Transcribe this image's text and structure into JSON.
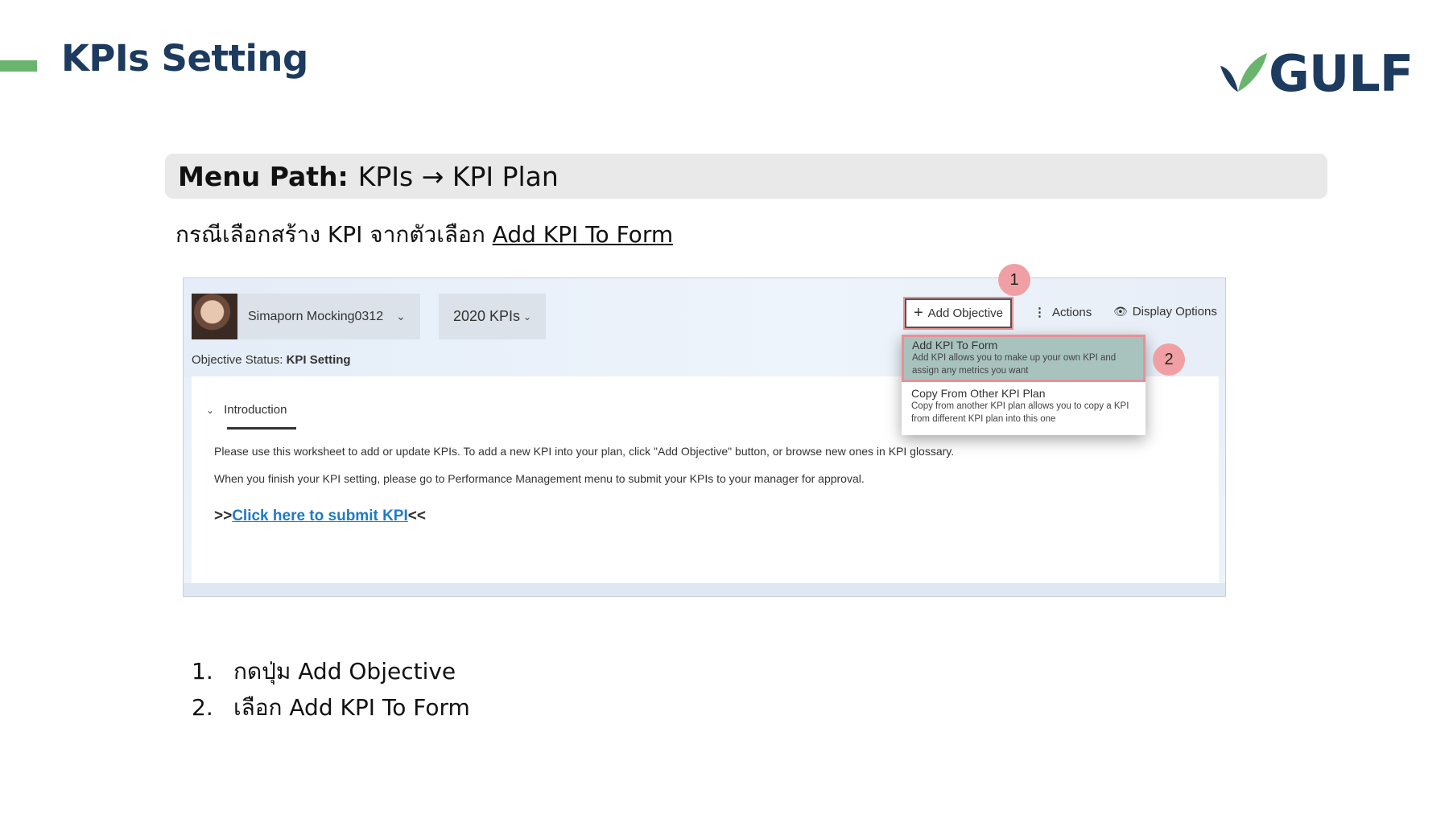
{
  "header": {
    "title": "KPIs Setting",
    "logo_text": "GULF",
    "colors": {
      "accent": "#69b56e",
      "title": "#1d3a5f"
    }
  },
  "menu_path": {
    "label": "Menu Path:",
    "path": "KPIs → KPI Plan"
  },
  "instruction": {
    "prefix": "กรณีเลือกสร้าง KPI จากตัวเลือก ",
    "link": "Add KPI To Form"
  },
  "screenshot": {
    "user_name": "Simaporn Mocking0312",
    "plan_name": "2020 KPIs",
    "objective_status_label": "Objective Status: ",
    "objective_status_value": "KPI Setting",
    "toolbar": {
      "add_objective": "Add Objective",
      "actions": "Actions",
      "display_options": "Display Options"
    },
    "dropdown": [
      {
        "title": "Add KPI To Form",
        "description": "Add KPI allows you to make up your own KPI and assign any metrics you want"
      },
      {
        "title": "Copy From Other KPI Plan",
        "description": "Copy from another KPI plan allows you to copy a KPI from different KPI plan into this one"
      }
    ],
    "intro_tab": "Introduction",
    "paragraph1": "Please use this worksheet to add or update KPIs. To add a new KPI into your plan, click \"Add Objective\" button, or browse new ones in KPI glossary.",
    "paragraph2": "When you finish your KPI setting, please go to Performance Management menu to submit your KPIs to your manager for approval.",
    "submit_prefix": ">>",
    "submit_link": "Click here to submit KPI",
    "submit_suffix": "<<",
    "badges": [
      "1",
      "2"
    ]
  },
  "steps": [
    {
      "num": "1.",
      "text": "กดปุ่ม Add Objective"
    },
    {
      "num": "2.",
      "text": "เลือก Add KPI To Form"
    }
  ]
}
